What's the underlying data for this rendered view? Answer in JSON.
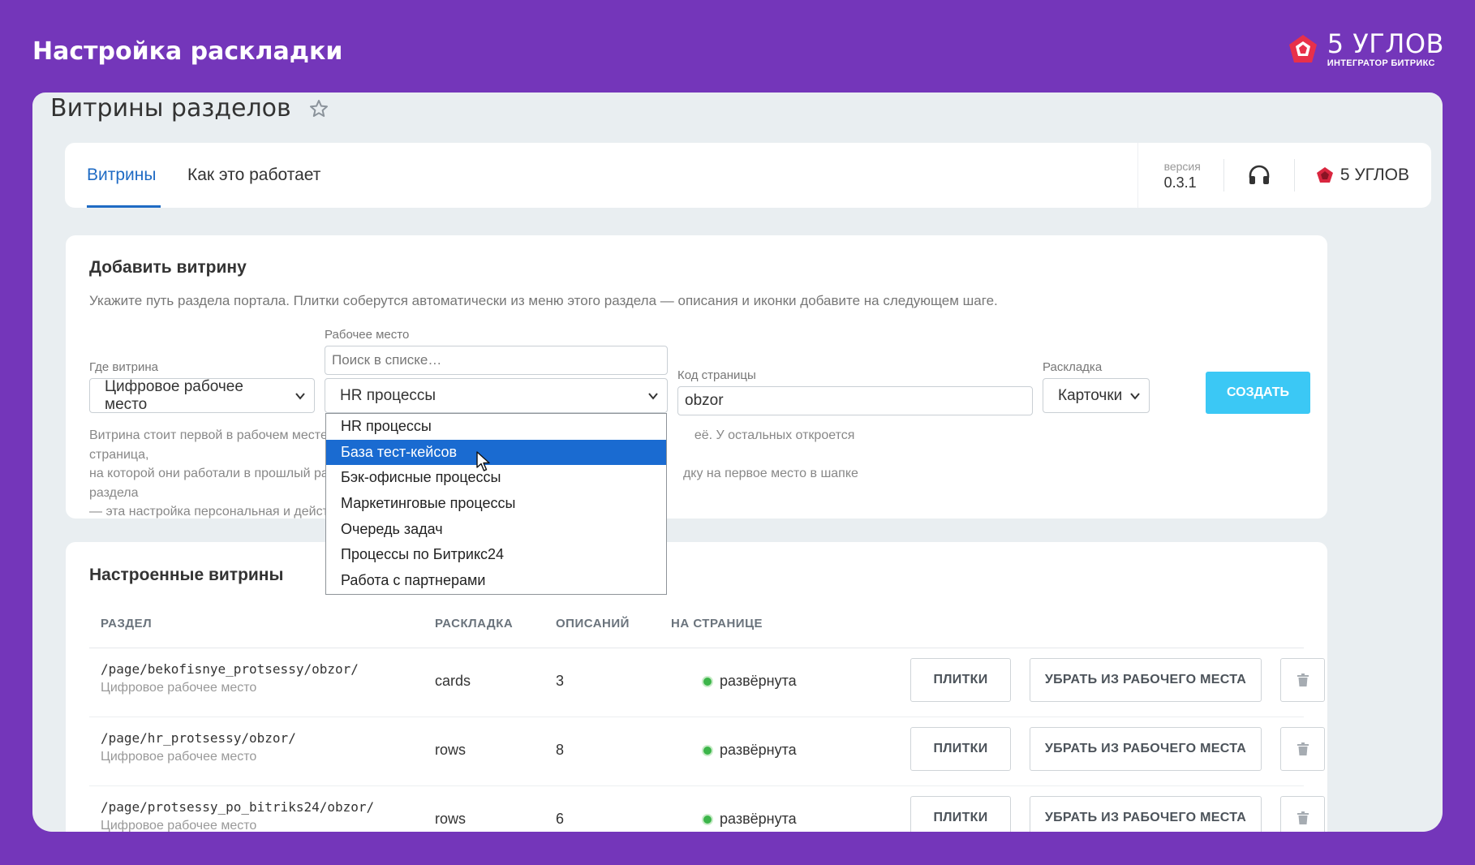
{
  "outer": {
    "title": "Настройка раскладки",
    "brand_name": "5 УГЛОВ",
    "brand_sub": "ИНТЕГРАТОР БИТРИКС"
  },
  "page": {
    "title": "Витрины разделов"
  },
  "tabs": {
    "items": [
      {
        "label": "Витрины",
        "active": true
      },
      {
        "label": "Как это работает",
        "active": false
      }
    ],
    "version_label": "версия",
    "version_value": "0.3.1",
    "vendor_name": "5 УГЛОВ"
  },
  "add_form": {
    "title": "Добавить витрину",
    "description": "Укажите путь раздела портала. Плитки соберутся автоматически из меню этого раздела — описания и иконки добавите на следующем шаге.",
    "where_label": "Где витрина",
    "where_value": "Цифровое рабочее место",
    "workspace_label": "Рабочее место",
    "workspace_search_placeholder": "Поиск в списке…",
    "workspace_value": "HR процессы",
    "page_code_label": "Код страницы",
    "page_code_value": "obzor",
    "layout_label": "Раскладка",
    "layout_value": "Карточки",
    "create_label": "СОЗДАТЬ",
    "hint_line1": "Витрина стоит первой в рабочем месте",
    "hint_line1_end": "её. У остальных откроется страница,",
    "hint_line2": "на которой они работали в прошлый раз",
    "hint_line2_end": "дку на первое место в шапке раздела",
    "hint_line3": "— эта настройка персональная и дейст"
  },
  "dropdown": {
    "options": [
      {
        "label": "HR процессы",
        "selected": false
      },
      {
        "label": "База тест-кейсов",
        "selected": true
      },
      {
        "label": "Бэк-офисные процессы",
        "selected": false
      },
      {
        "label": "Маркетинговые процессы",
        "selected": false
      },
      {
        "label": "Очередь задач",
        "selected": false
      },
      {
        "label": "Процессы по Битрикс24",
        "selected": false
      },
      {
        "label": "Работа с партнерами",
        "selected": false
      }
    ]
  },
  "list": {
    "title": "Настроенные витрины",
    "columns": [
      "РАЗДЕЛ",
      "РАСКЛАДКА",
      "ОПИСАНИЙ",
      "НА СТРАНИЦЕ"
    ],
    "rows": [
      {
        "path": "/page/bekofisnye_protsessy/obzor/",
        "sub": "Цифровое рабочее место",
        "layout": "cards",
        "count": "3",
        "status": "развёрнута"
      },
      {
        "path": "/page/hr_protsessy/obzor/",
        "sub": "Цифровое рабочее место",
        "layout": "rows",
        "count": "8",
        "status": "развёрнута"
      },
      {
        "path": "/page/protsessy_po_bitriks24/obzor/",
        "sub": "Цифровое рабочее место",
        "layout": "rows",
        "count": "6",
        "status": "развёрнута"
      }
    ],
    "tiles_label": "ПЛИТКИ",
    "remove_label": "УБРАТЬ ИЗ РАБОЧЕГО МЕСТА"
  },
  "colors": {
    "background": "#7436ba",
    "accent": "#1f6bc4",
    "create_button": "#3bc8f5",
    "dropdown_selected": "#1a6bd1",
    "status_ok": "#3cb54a"
  }
}
